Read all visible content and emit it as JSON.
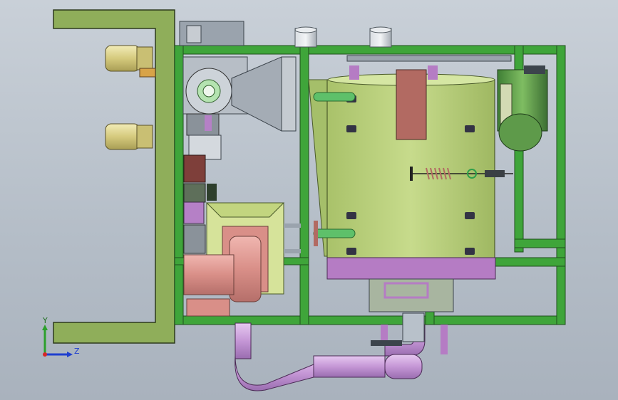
{
  "view": {
    "axis_triad": {
      "y_label": "Y",
      "z_label": "Z"
    },
    "colors": {
      "frame_green": "#3fa53a",
      "panel_olive": "#8fae5a",
      "tank_body": "#b9cf7b",
      "tank_shadow": "#9bb55f",
      "hopper_pink": "#d9938f",
      "pipe_violet": "#c898d8",
      "base_violet": "#b57cc4",
      "motor_green": "#5e9a4a",
      "steel_grey": "#9aa3ad",
      "cylinder_tan": "#d8cf86",
      "lid_rose": "#b26a62"
    }
  }
}
